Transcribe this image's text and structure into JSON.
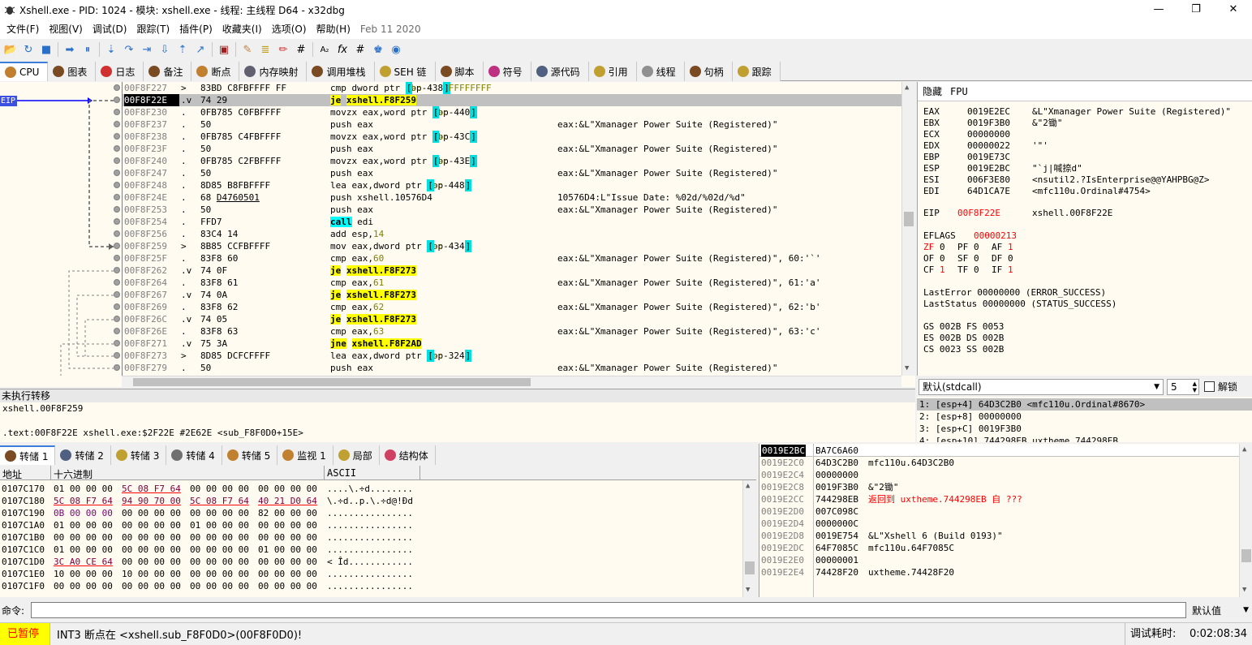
{
  "window": {
    "title": "Xshell.exe - PID: 1024 - 模块: xshell.exe - 线程: 主线程 D64 - x32dbg",
    "minimize": "—",
    "maximize": "❐",
    "close": "✕"
  },
  "menu": {
    "items": [
      "文件(F)",
      "视图(V)",
      "调试(D)",
      "跟踪(T)",
      "插件(P)",
      "收藏夹(I)",
      "选项(O)",
      "帮助(H)"
    ],
    "date": "Feb 11 2020"
  },
  "toolbar": {
    "buttons": [
      "📂",
      "↻",
      "■",
      "➡",
      "⏸",
      "⇣",
      "↷",
      "⇥",
      "⇩",
      "⇡",
      "↗",
      "▣",
      "✎",
      "≣",
      "✏",
      "#",
      "A₂",
      "fx",
      "#",
      "♚",
      "◉"
    ]
  },
  "tabs": {
    "items": [
      "CPU",
      "图表",
      "日志",
      "备注",
      "断点",
      "内存映射",
      "调用堆栈",
      "SEH 链",
      "脚本",
      "符号",
      "源代码",
      "引用",
      "线程",
      "句柄",
      "跟踪"
    ]
  },
  "disasm": {
    "eip_label": "EIP",
    "rows": [
      {
        "addr": "00F8F227",
        "mk": ">",
        "bytes": "83BD C8FBFFFF FF",
        "ins": "cmp dword ptr ss:[ebp-438],FFFFFFFF",
        "cmt": ""
      },
      {
        "addr": "00F8F22E",
        "mk": ".v",
        "bytes": "74 29",
        "ins": "je xshell.F8F259",
        "cmt": ""
      },
      {
        "addr": "00F8F230",
        "mk": ".",
        "bytes": "0FB785 C0FBFFFF",
        "ins": "movzx eax,word ptr ss:[ebp-440]",
        "cmt": ""
      },
      {
        "addr": "00F8F237",
        "mk": ".",
        "bytes": "50",
        "ins": "push eax",
        "cmt": "eax:&L\"Xmanager Power Suite  (Registered)\""
      },
      {
        "addr": "00F8F238",
        "mk": ".",
        "bytes": "0FB785 C4FBFFFF",
        "ins": "movzx eax,word ptr ss:[ebp-43C]",
        "cmt": ""
      },
      {
        "addr": "00F8F23F",
        "mk": ".",
        "bytes": "50",
        "ins": "push eax",
        "cmt": "eax:&L\"Xmanager Power Suite  (Registered)\""
      },
      {
        "addr": "00F8F240",
        "mk": ".",
        "bytes": "0FB785 C2FBFFFF",
        "ins": "movzx eax,word ptr ss:[ebp-43E]",
        "cmt": ""
      },
      {
        "addr": "00F8F247",
        "mk": ".",
        "bytes": "50",
        "ins": "push eax",
        "cmt": "eax:&L\"Xmanager Power Suite  (Registered)\""
      },
      {
        "addr": "00F8F248",
        "mk": ".",
        "bytes": "8D85 B8FBFFFF",
        "ins": "lea eax,dword ptr ss:[ebp-448]",
        "cmt": ""
      },
      {
        "addr": "00F8F24E",
        "mk": ".",
        "bytes": "68 D4760501",
        "ins": "push xshell.10576D4",
        "cmt": "10576D4:L\"Issue Date: %02d/%02d/%d\""
      },
      {
        "addr": "00F8F253",
        "mk": ".",
        "bytes": "50",
        "ins": "push eax",
        "cmt": "eax:&L\"Xmanager Power Suite  (Registered)\""
      },
      {
        "addr": "00F8F254",
        "mk": ".",
        "bytes": "FFD7",
        "ins": "call edi",
        "cmt": ""
      },
      {
        "addr": "00F8F256",
        "mk": ".",
        "bytes": "83C4 14",
        "ins": "add esp,14",
        "cmt": ""
      },
      {
        "addr": "00F8F259",
        "mk": ">",
        "bytes": "8B85 CCFBFFFF",
        "ins": "mov eax,dword ptr ss:[ebp-434]",
        "cmt": ""
      },
      {
        "addr": "00F8F25F",
        "mk": ".",
        "bytes": "83F8 60",
        "ins": "cmp eax,60",
        "cmt": "eax:&L\"Xmanager Power Suite  (Registered)\", 60:'`'"
      },
      {
        "addr": "00F8F262",
        "mk": ".v",
        "bytes": "74 0F",
        "ins": "je xshell.F8F273",
        "cmt": ""
      },
      {
        "addr": "00F8F264",
        "mk": ".",
        "bytes": "83F8 61",
        "ins": "cmp eax,61",
        "cmt": "eax:&L\"Xmanager Power Suite  (Registered)\", 61:'a'"
      },
      {
        "addr": "00F8F267",
        "mk": ".v",
        "bytes": "74 0A",
        "ins": "je xshell.F8F273",
        "cmt": ""
      },
      {
        "addr": "00F8F269",
        "mk": ".",
        "bytes": "83F8 62",
        "ins": "cmp eax,62",
        "cmt": "eax:&L\"Xmanager Power Suite  (Registered)\", 62:'b'"
      },
      {
        "addr": "00F8F26C",
        "mk": ".v",
        "bytes": "74 05",
        "ins": "je xshell.F8F273",
        "cmt": ""
      },
      {
        "addr": "00F8F26E",
        "mk": ".",
        "bytes": "83F8 63",
        "ins": "cmp eax,63",
        "cmt": "eax:&L\"Xmanager Power Suite  (Registered)\", 63:'c'"
      },
      {
        "addr": "00F8F271",
        "mk": ".v",
        "bytes": "75 3A",
        "ins": "jne xshell.F8F2AD",
        "cmt": ""
      },
      {
        "addr": "00F8F273",
        "mk": ">",
        "bytes": "8D85 DCFCFFFF",
        "ins": "lea eax,dword ptr ss:[ebp-324]",
        "cmt": ""
      },
      {
        "addr": "00F8F279",
        "mk": ".",
        "bytes": "50",
        "ins": "push eax",
        "cmt": "eax:&L\"Xmanager Power Suite  (Registered)\""
      }
    ]
  },
  "registers": {
    "tab_hide": "隐藏",
    "tab_fpu": "FPU",
    "gp": [
      {
        "name": "EAX",
        "value": "0019E2EC",
        "comment": "&L\"Xmanager Power Suite  (Registered)\""
      },
      {
        "name": "EBX",
        "value": "0019F3B0",
        "comment": "&\"2锄\""
      },
      {
        "name": "ECX",
        "value": "00000000",
        "comment": ""
      },
      {
        "name": "EDX",
        "value": "00000022",
        "comment": "'\"'"
      },
      {
        "name": "EBP",
        "value": "0019E73C",
        "comment": ""
      },
      {
        "name": "ESP",
        "value": "0019E2BC",
        "comment": "\"`j|喊捺d\""
      },
      {
        "name": "ESI",
        "value": "006F3E80",
        "comment": "<nsutil2.?IsEnterprise@@YAHPBG@Z>"
      },
      {
        "name": "EDI",
        "value": "64D1CA7E",
        "comment": "<mfc110u.Ordinal#4754>"
      }
    ],
    "eip": {
      "name": "EIP",
      "value": "00F8F22E",
      "comment": "xshell.00F8F22E"
    },
    "eflags": {
      "name": "EFLAGS",
      "value": "00000213"
    },
    "flags": [
      [
        "ZF",
        "0",
        "PF",
        "0",
        "AF",
        "1"
      ],
      [
        "OF",
        "0",
        "SF",
        "0",
        "DF",
        "0"
      ],
      [
        "CF",
        "1",
        "TF",
        "0",
        "IF",
        "1"
      ]
    ],
    "last_error": "LastError  00000000 (ERROR_SUCCESS)",
    "last_status": "LastStatus 00000000 (STATUS_SUCCESS)",
    "segs": [
      "GS 002B  FS 0053",
      "ES 002B  DS 002B",
      "CS 0023  SS 002B"
    ]
  },
  "callconv": {
    "selected": "默认(stdcall)",
    "count": "5",
    "unlock": "解锁"
  },
  "stack_args": [
    "1: [esp+4] 64D3C2B0 <mfc110u.Ordinal#8670>",
    "2: [esp+8] 00000000",
    "3: [esp+C] 0019F3B0",
    "4: [esp+10] 744298EB uxtheme.744298EB"
  ],
  "info": {
    "header": "未执行转移",
    "line1": "xshell.00F8F259",
    "line2": "",
    "line3": ".text:00F8F22E xshell.exe:$2F22E #2E62E <sub_F8F0D0+15E>"
  },
  "dumptabs": {
    "items": [
      "转储 1",
      "转储 2",
      "转储 3",
      "转储 4",
      "转储 5",
      "监视 1",
      "局部",
      "结构体"
    ]
  },
  "dump": {
    "col_addr": "地址",
    "col_hex": "十六进制",
    "col_ascii": "ASCII",
    "rows": [
      {
        "addr": "0107C170",
        "hex": [
          "01 00 00 00",
          "5C 08 F7 64",
          "00 00 00 00",
          "00 00 00 00"
        ],
        "ascii": "....\\.÷d........"
      },
      {
        "addr": "0107C180",
        "hex": [
          "5C 08 F7 64",
          "94 90 70 00",
          "5C 08 F7 64",
          "40 21 D0 64"
        ],
        "ascii": "\\.÷d..p.\\.÷d@!Ðd"
      },
      {
        "addr": "0107C190",
        "hex": [
          "0B 00 00 00",
          "00 00 00 00",
          "00 00 00 00",
          "82 00 00 00"
        ],
        "ascii": "................"
      },
      {
        "addr": "0107C1A0",
        "hex": [
          "01 00 00 00",
          "00 00 00 00",
          "01 00 00 00",
          "00 00 00 00"
        ],
        "ascii": "................"
      },
      {
        "addr": "0107C1B0",
        "hex": [
          "00 00 00 00",
          "00 00 00 00",
          "00 00 00 00",
          "00 00 00 00"
        ],
        "ascii": "................"
      },
      {
        "addr": "0107C1C0",
        "hex": [
          "01 00 00 00",
          "00 00 00 00",
          "00 00 00 00",
          "01 00 00 00"
        ],
        "ascii": "................"
      },
      {
        "addr": "0107C1D0",
        "hex": [
          "3C A0 CE 64",
          "00 00 00 00",
          "00 00 00 00",
          "00 00 00 00"
        ],
        "ascii": "< Îd............"
      },
      {
        "addr": "0107C1E0",
        "hex": [
          "10 00 00 00",
          "10 00 00 00",
          "00 00 00 00",
          "00 00 00 00"
        ],
        "ascii": "................"
      },
      {
        "addr": "0107C1F0",
        "hex": [
          "00 00 00 00",
          "00 00 00 00",
          "00 00 00 00",
          "00 00 00 00"
        ],
        "ascii": "................"
      }
    ]
  },
  "stack": {
    "rows": [
      {
        "addr": "0019E2BC",
        "val": "BA7C6A60",
        "cmt": ""
      },
      {
        "addr": "0019E2C0",
        "val": "64D3C2B0",
        "cmt": "mfc110u.64D3C2B0"
      },
      {
        "addr": "0019E2C4",
        "val": "00000000",
        "cmt": ""
      },
      {
        "addr": "0019E2C8",
        "val": "0019F3B0",
        "cmt": "&\"2锄\""
      },
      {
        "addr": "0019E2CC",
        "val": "744298EB",
        "cmt": "返回到 uxtheme.744298EB 自 ???"
      },
      {
        "addr": "0019E2D0",
        "val": "007C098C",
        "cmt": ""
      },
      {
        "addr": "0019E2D4",
        "val": "0000000C",
        "cmt": ""
      },
      {
        "addr": "0019E2D8",
        "val": "0019E754",
        "cmt": "&L\"Xshell 6 (Build 0193)\""
      },
      {
        "addr": "0019E2DC",
        "val": "64F7085C",
        "cmt": "mfc110u.64F7085C"
      },
      {
        "addr": "0019E2E0",
        "val": "00000001",
        "cmt": ""
      },
      {
        "addr": "0019E2E4",
        "val": "74428F20",
        "cmt": "uxtheme.74428F20"
      }
    ]
  },
  "command": {
    "label": "命令:",
    "value": "",
    "default_value": "默认值"
  },
  "status": {
    "paused": "已暂停",
    "message": "INT3 断点在 <xshell.sub_F8F0D0>(00F8F0D0)!",
    "timer_label": "调试耗时:",
    "timer_value": "0:02:08:34"
  },
  "colors": {
    "panel_bg": "#fffbf0",
    "jump_highlight": "#ffff00",
    "call_highlight": "#00ffff",
    "eip_marker": "#0000ff",
    "red_text": "#ff0000",
    "paused_bg": "#ffff00"
  }
}
